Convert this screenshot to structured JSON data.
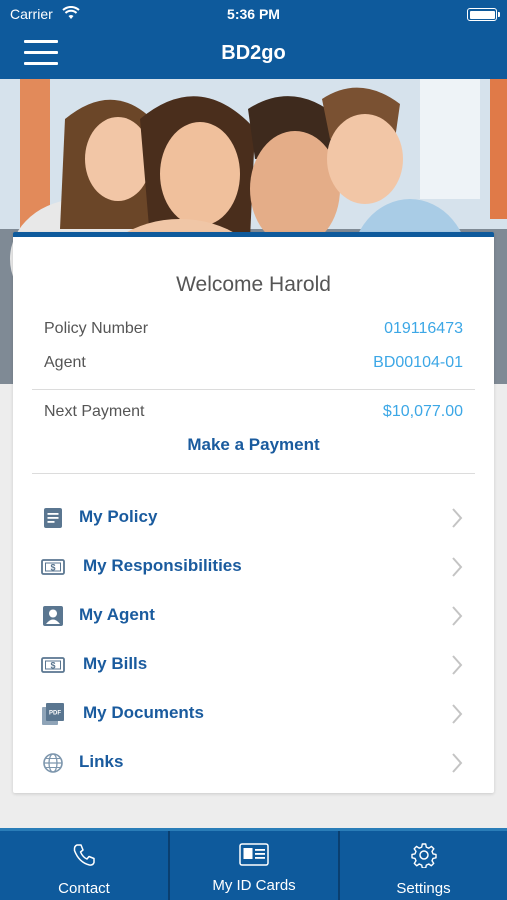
{
  "status": {
    "carrier": "Carrier",
    "time": "5:36 PM"
  },
  "nav": {
    "title": "BD2go"
  },
  "card": {
    "welcome": "Welcome Harold",
    "policy_label": "Policy Number",
    "policy_value": "019116473",
    "agent_label": "Agent",
    "agent_value": "BD00104-01",
    "payment_label": "Next Payment",
    "payment_value": "$10,077.00",
    "pay_link": "Make a Payment"
  },
  "menu": [
    {
      "label": "My Policy",
      "icon": "document-icon"
    },
    {
      "label": "My Responsibilities",
      "icon": "dollar-bill-icon"
    },
    {
      "label": "My Agent",
      "icon": "person-icon"
    },
    {
      "label": "My Bills",
      "icon": "dollar-bill-icon"
    },
    {
      "label": "My Documents",
      "icon": "pdf-icon"
    },
    {
      "label": "Links",
      "icon": "globe-icon"
    }
  ],
  "tabs": [
    {
      "label": "Contact",
      "icon": "phone-icon"
    },
    {
      "label": "My ID Cards",
      "icon": "id-card-icon"
    },
    {
      "label": "Settings",
      "icon": "gear-icon"
    }
  ],
  "colors": {
    "brand": "#0e5a9c",
    "accent": "#3ca7e6",
    "link": "#1a5b9e"
  }
}
